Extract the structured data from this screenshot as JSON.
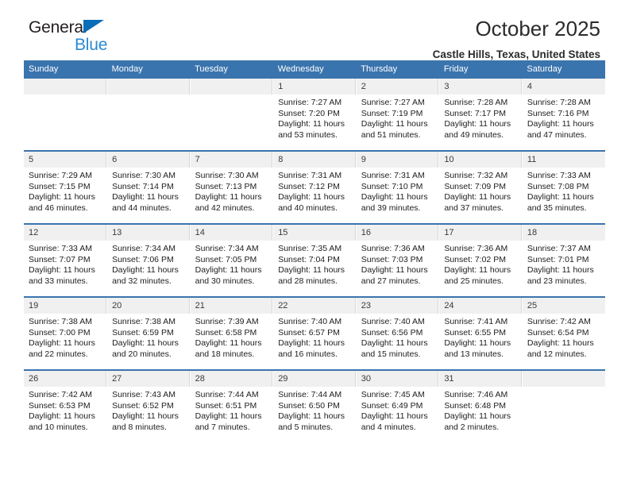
{
  "brand": {
    "line1": "General",
    "line2": "Blue",
    "triangle_color": "#0b6cb7",
    "line2_color": "#2a8ad4"
  },
  "header": {
    "title": "October 2025",
    "subtitle": "Castle Hills, Texas, United States",
    "accent_color": "#3a74ae"
  },
  "weekday_headers": [
    "Sunday",
    "Monday",
    "Tuesday",
    "Wednesday",
    "Thursday",
    "Friday",
    "Saturday"
  ],
  "weeks": [
    [
      {
        "day": "",
        "lines": []
      },
      {
        "day": "",
        "lines": []
      },
      {
        "day": "",
        "lines": []
      },
      {
        "day": "1",
        "lines": [
          "Sunrise: 7:27 AM",
          "Sunset: 7:20 PM",
          "Daylight: 11 hours",
          "and 53 minutes."
        ]
      },
      {
        "day": "2",
        "lines": [
          "Sunrise: 7:27 AM",
          "Sunset: 7:19 PM",
          "Daylight: 11 hours",
          "and 51 minutes."
        ]
      },
      {
        "day": "3",
        "lines": [
          "Sunrise: 7:28 AM",
          "Sunset: 7:17 PM",
          "Daylight: 11 hours",
          "and 49 minutes."
        ]
      },
      {
        "day": "4",
        "lines": [
          "Sunrise: 7:28 AM",
          "Sunset: 7:16 PM",
          "Daylight: 11 hours",
          "and 47 minutes."
        ]
      }
    ],
    [
      {
        "day": "5",
        "lines": [
          "Sunrise: 7:29 AM",
          "Sunset: 7:15 PM",
          "Daylight: 11 hours",
          "and 46 minutes."
        ]
      },
      {
        "day": "6",
        "lines": [
          "Sunrise: 7:30 AM",
          "Sunset: 7:14 PM",
          "Daylight: 11 hours",
          "and 44 minutes."
        ]
      },
      {
        "day": "7",
        "lines": [
          "Sunrise: 7:30 AM",
          "Sunset: 7:13 PM",
          "Daylight: 11 hours",
          "and 42 minutes."
        ]
      },
      {
        "day": "8",
        "lines": [
          "Sunrise: 7:31 AM",
          "Sunset: 7:12 PM",
          "Daylight: 11 hours",
          "and 40 minutes."
        ]
      },
      {
        "day": "9",
        "lines": [
          "Sunrise: 7:31 AM",
          "Sunset: 7:10 PM",
          "Daylight: 11 hours",
          "and 39 minutes."
        ]
      },
      {
        "day": "10",
        "lines": [
          "Sunrise: 7:32 AM",
          "Sunset: 7:09 PM",
          "Daylight: 11 hours",
          "and 37 minutes."
        ]
      },
      {
        "day": "11",
        "lines": [
          "Sunrise: 7:33 AM",
          "Sunset: 7:08 PM",
          "Daylight: 11 hours",
          "and 35 minutes."
        ]
      }
    ],
    [
      {
        "day": "12",
        "lines": [
          "Sunrise: 7:33 AM",
          "Sunset: 7:07 PM",
          "Daylight: 11 hours",
          "and 33 minutes."
        ]
      },
      {
        "day": "13",
        "lines": [
          "Sunrise: 7:34 AM",
          "Sunset: 7:06 PM",
          "Daylight: 11 hours",
          "and 32 minutes."
        ]
      },
      {
        "day": "14",
        "lines": [
          "Sunrise: 7:34 AM",
          "Sunset: 7:05 PM",
          "Daylight: 11 hours",
          "and 30 minutes."
        ]
      },
      {
        "day": "15",
        "lines": [
          "Sunrise: 7:35 AM",
          "Sunset: 7:04 PM",
          "Daylight: 11 hours",
          "and 28 minutes."
        ]
      },
      {
        "day": "16",
        "lines": [
          "Sunrise: 7:36 AM",
          "Sunset: 7:03 PM",
          "Daylight: 11 hours",
          "and 27 minutes."
        ]
      },
      {
        "day": "17",
        "lines": [
          "Sunrise: 7:36 AM",
          "Sunset: 7:02 PM",
          "Daylight: 11 hours",
          "and 25 minutes."
        ]
      },
      {
        "day": "18",
        "lines": [
          "Sunrise: 7:37 AM",
          "Sunset: 7:01 PM",
          "Daylight: 11 hours",
          "and 23 minutes."
        ]
      }
    ],
    [
      {
        "day": "19",
        "lines": [
          "Sunrise: 7:38 AM",
          "Sunset: 7:00 PM",
          "Daylight: 11 hours",
          "and 22 minutes."
        ]
      },
      {
        "day": "20",
        "lines": [
          "Sunrise: 7:38 AM",
          "Sunset: 6:59 PM",
          "Daylight: 11 hours",
          "and 20 minutes."
        ]
      },
      {
        "day": "21",
        "lines": [
          "Sunrise: 7:39 AM",
          "Sunset: 6:58 PM",
          "Daylight: 11 hours",
          "and 18 minutes."
        ]
      },
      {
        "day": "22",
        "lines": [
          "Sunrise: 7:40 AM",
          "Sunset: 6:57 PM",
          "Daylight: 11 hours",
          "and 16 minutes."
        ]
      },
      {
        "day": "23",
        "lines": [
          "Sunrise: 7:40 AM",
          "Sunset: 6:56 PM",
          "Daylight: 11 hours",
          "and 15 minutes."
        ]
      },
      {
        "day": "24",
        "lines": [
          "Sunrise: 7:41 AM",
          "Sunset: 6:55 PM",
          "Daylight: 11 hours",
          "and 13 minutes."
        ]
      },
      {
        "day": "25",
        "lines": [
          "Sunrise: 7:42 AM",
          "Sunset: 6:54 PM",
          "Daylight: 11 hours",
          "and 12 minutes."
        ]
      }
    ],
    [
      {
        "day": "26",
        "lines": [
          "Sunrise: 7:42 AM",
          "Sunset: 6:53 PM",
          "Daylight: 11 hours",
          "and 10 minutes."
        ]
      },
      {
        "day": "27",
        "lines": [
          "Sunrise: 7:43 AM",
          "Sunset: 6:52 PM",
          "Daylight: 11 hours",
          "and 8 minutes."
        ]
      },
      {
        "day": "28",
        "lines": [
          "Sunrise: 7:44 AM",
          "Sunset: 6:51 PM",
          "Daylight: 11 hours",
          "and 7 minutes."
        ]
      },
      {
        "day": "29",
        "lines": [
          "Sunrise: 7:44 AM",
          "Sunset: 6:50 PM",
          "Daylight: 11 hours",
          "and 5 minutes."
        ]
      },
      {
        "day": "30",
        "lines": [
          "Sunrise: 7:45 AM",
          "Sunset: 6:49 PM",
          "Daylight: 11 hours",
          "and 4 minutes."
        ]
      },
      {
        "day": "31",
        "lines": [
          "Sunrise: 7:46 AM",
          "Sunset: 6:48 PM",
          "Daylight: 11 hours",
          "and 2 minutes."
        ]
      },
      {
        "day": "",
        "lines": []
      }
    ]
  ]
}
